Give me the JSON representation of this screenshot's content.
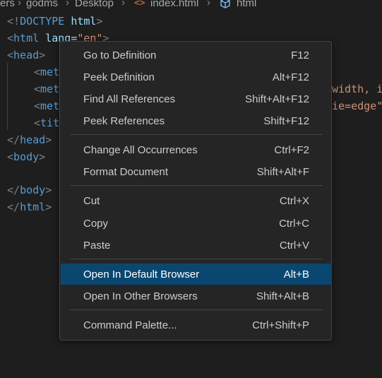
{
  "breadcrumb": {
    "segments": [
      "ers",
      "godms",
      "Desktop",
      "index.html",
      "html"
    ],
    "separator": "›",
    "file_icon": "html-file-icon",
    "element_icon": "cube-icon"
  },
  "code": {
    "line1": {
      "open": "<!",
      "tag": "DOCTYPE",
      "sp": " ",
      "attr": "html",
      "close": ">"
    },
    "line2": {
      "open": "<",
      "tag": "html",
      "sp": " ",
      "attr": "lang",
      "eq": "=",
      "val": "\"en\"",
      "close": ">"
    },
    "line3": {
      "open": "<",
      "tag": "head",
      "close": ">"
    },
    "line4": {
      "open": "<",
      "tag": "met"
    },
    "line5": {
      "open": "<",
      "tag": "met",
      "tail": "width, i"
    },
    "line6": {
      "open": "<",
      "tag": "met",
      "tail": "ie=edge\""
    },
    "line7": {
      "open": "<",
      "tag": "tit"
    },
    "line8": {
      "open": "</",
      "tag": "head",
      "close": ">"
    },
    "line9": {
      "open": "<",
      "tag": "body",
      "close": ">"
    },
    "line11": {
      "open": "</",
      "tag": "body",
      "close": ">"
    },
    "line12": {
      "open": "</",
      "tag": "html",
      "close": ">"
    }
  },
  "context_menu": {
    "items": [
      {
        "label": "Go to Definition",
        "shortcut": "F12"
      },
      {
        "label": "Peek Definition",
        "shortcut": "Alt+F12"
      },
      {
        "label": "Find All References",
        "shortcut": "Shift+Alt+F12"
      },
      {
        "label": "Peek References",
        "shortcut": "Shift+F12"
      },
      {
        "label": "Change All Occurrences",
        "shortcut": "Ctrl+F2"
      },
      {
        "label": "Format Document",
        "shortcut": "Shift+Alt+F"
      },
      {
        "label": "Cut",
        "shortcut": "Ctrl+X"
      },
      {
        "label": "Copy",
        "shortcut": "Ctrl+C"
      },
      {
        "label": "Paste",
        "shortcut": "Ctrl+V"
      },
      {
        "label": "Open In Default Browser",
        "shortcut": "Alt+B"
      },
      {
        "label": "Open In Other Browsers",
        "shortcut": "Shift+Alt+B"
      },
      {
        "label": "Command Palette...",
        "shortcut": "Ctrl+Shift+P"
      }
    ],
    "selected_label": "Open In Default Browser"
  },
  "colors": {
    "editor_bg": "#1e1e1e",
    "menu_bg": "#252526",
    "selection": "#094771",
    "tag": "#569cd6",
    "attribute": "#9cdcfe",
    "string": "#ce9178",
    "punctuation": "#808080"
  }
}
